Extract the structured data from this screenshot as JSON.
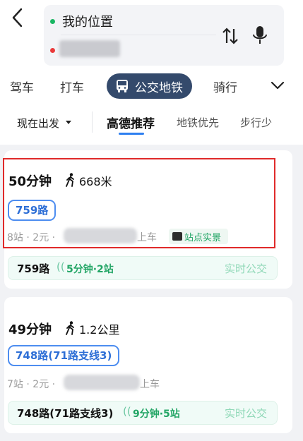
{
  "header": {
    "from_label": "我的位置",
    "to_label": ""
  },
  "modes": [
    {
      "label": "驾车"
    },
    {
      "label": "打车"
    },
    {
      "label": "公交地铁"
    },
    {
      "label": "骑行"
    }
  ],
  "filters": {
    "depart": "现在出发",
    "tabs": [
      "高德推荐",
      "地铁优先",
      "步行少"
    ]
  },
  "routes": [
    {
      "duration": "50分钟",
      "walk": "668米",
      "route_label": "759路",
      "stops": "8站",
      "fare": "2元",
      "board_suffix": "上车",
      "badge": "站点实景",
      "rt_route": "759路",
      "rt_eta": "5分钟·2站",
      "rt_label": "实时公交"
    },
    {
      "duration": "49分钟",
      "walk": "1.2公里",
      "route_label": "748路(71路支线3)",
      "stops": "7站",
      "fare": "2元",
      "board_suffix": "上车",
      "rt_route": "748路(71路支线3)",
      "rt_eta": "9分钟·5站",
      "rt_label": "实时公交"
    }
  ],
  "colors": {
    "accent_blue": "#2e7ff0",
    "active_mode_bg": "#344a6c",
    "realtime_green": "#22a565",
    "highlight_red": "#e02a2a"
  }
}
